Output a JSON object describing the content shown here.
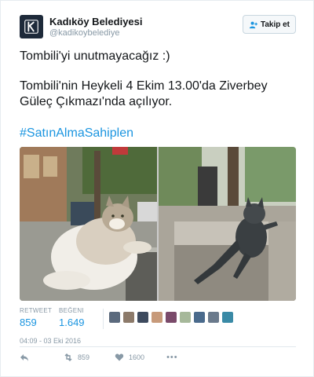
{
  "account": {
    "name": "Kadıköy Belediyesi",
    "handle": "@kadikoybelediye",
    "follow_label": "Takip et"
  },
  "tweet": {
    "line1": "Tombili'yi unutmayacağız :)",
    "line2": "Tombili'nin Heykeli 4 Ekim 13.00'da Ziverbey",
    "line3": "Güleç Çıkmazı'nda açılıyor.",
    "hashtag": "#SatınAlmaSahiplen"
  },
  "media": {
    "photos": [
      "cat-photo",
      "cat-statue-photo"
    ]
  },
  "stats": {
    "retweet_label": "RETWEET",
    "retweet_count": "859",
    "likes_label": "BEĞENI",
    "likes_count": "1.649"
  },
  "likers": {
    "colors": [
      "#5b6a7d",
      "#8c7a6a",
      "#3d4a5e",
      "#c79a7a",
      "#7a4a6a",
      "#a6b89a",
      "#4a6a8c",
      "#6a7a8c",
      "#3a8aa6"
    ]
  },
  "timestamp": "04:09 - 03 Eki 2016",
  "actions": {
    "reply_icon": "reply-icon",
    "retweet_count": "859",
    "like_count": "1600",
    "more_label": "•••"
  },
  "colors": {
    "link": "#1b95e0",
    "muted": "#8899a6",
    "text": "#14171a",
    "border": "#e1e8ed"
  }
}
